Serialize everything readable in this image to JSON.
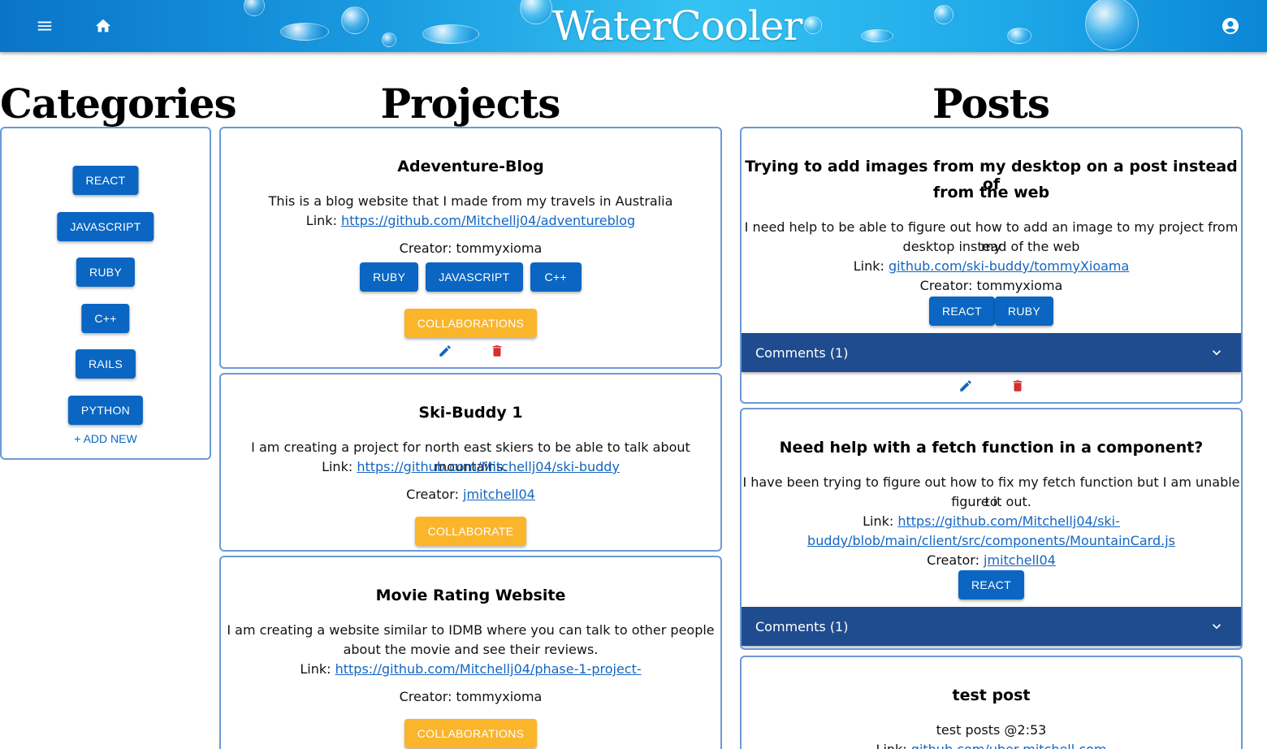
{
  "header": {
    "title": "WaterCooler",
    "menu_icon": "menu-icon",
    "home_icon": "home-icon",
    "account_icon": "account-circle-icon"
  },
  "colors": {
    "primary_button": "#0a66c2",
    "collab_button": "#fbb52b",
    "comments_bar": "#1f4c8f",
    "panel_border": "#6b9ad6",
    "edit_icon": "#1565c0",
    "delete_icon": "#d32f2f"
  },
  "categories": {
    "heading": "Categories",
    "items": [
      "REACT",
      "JAVASCRIPT",
      "RUBY",
      "C++",
      "RAILS",
      "PYTHON"
    ],
    "add_new": "+ ADD NEW"
  },
  "projects": {
    "heading": "Projects",
    "items": [
      {
        "title": "Adeventure-Blog",
        "description": "This is a blog website that I made from my travels in Australia",
        "link_label": "Link: ",
        "link": "https://github.com/Mitchellj04/adventureblog",
        "creator_label": "Creator: ",
        "creator": "tommyxioma",
        "tags": [
          "RUBY",
          "JAVASCRIPT",
          "C++"
        ],
        "action": "COLLABORATIONS"
      },
      {
        "title": "Ski-Buddy 1",
        "description": "I am creating a project for north east skiers to be able to talk about mountains.",
        "link_label": "Link: ",
        "link": "https://github.com/Mitchellj04/ski-buddy",
        "creator_label": "Creator: ",
        "creator": "jmitchell04",
        "action": "COLLABORATE"
      },
      {
        "title": "Movie Rating Website",
        "description_line1": "I am creating a website similar to IDMB where you can talk to other people",
        "description_line2": "about the movie and see their reviews.",
        "link_label": "Link: ",
        "link": "https://github.com/Mitchellj04/phase-1-project-",
        "creator_label": "Creator: ",
        "creator": "tommyxioma",
        "action": "COLLABORATIONS"
      }
    ]
  },
  "posts": {
    "heading": "Posts",
    "items": [
      {
        "title_line1": "Trying to add images from my desktop on a post instead of",
        "title_line2": "from the web",
        "body_line1": "I need help to be able to figure out how to add an image to my project from my",
        "body_line2": "desktop instead of the web",
        "link_label": "Link: ",
        "link": "github.com/ski-buddy/tommyXioama",
        "creator_label": "Creator: ",
        "creator": "tommyxioma",
        "tags": [
          "REACT",
          "RUBY"
        ],
        "comments": "Comments (1)"
      },
      {
        "title": "Need help with a fetch function in a component?",
        "body_line1": "I have been trying to figure out how to fix my fetch function but I am unable to",
        "body_line2": "figure it out.",
        "link_label": "Link: ",
        "link_line1": " https://github.com/Mitchellj04/ski-",
        "link_line2": "buddy/blob/main/client/src/components/MountainCard.js",
        "creator_label": "Creator: ",
        "creator": "jmitchell04",
        "tags": [
          "REACT"
        ],
        "comments": "Comments (1)"
      },
      {
        "title": "test post",
        "body": "test posts @2:53",
        "link_label": "Link: ",
        "link": "github.com/uber-mitchell.com"
      }
    ]
  }
}
